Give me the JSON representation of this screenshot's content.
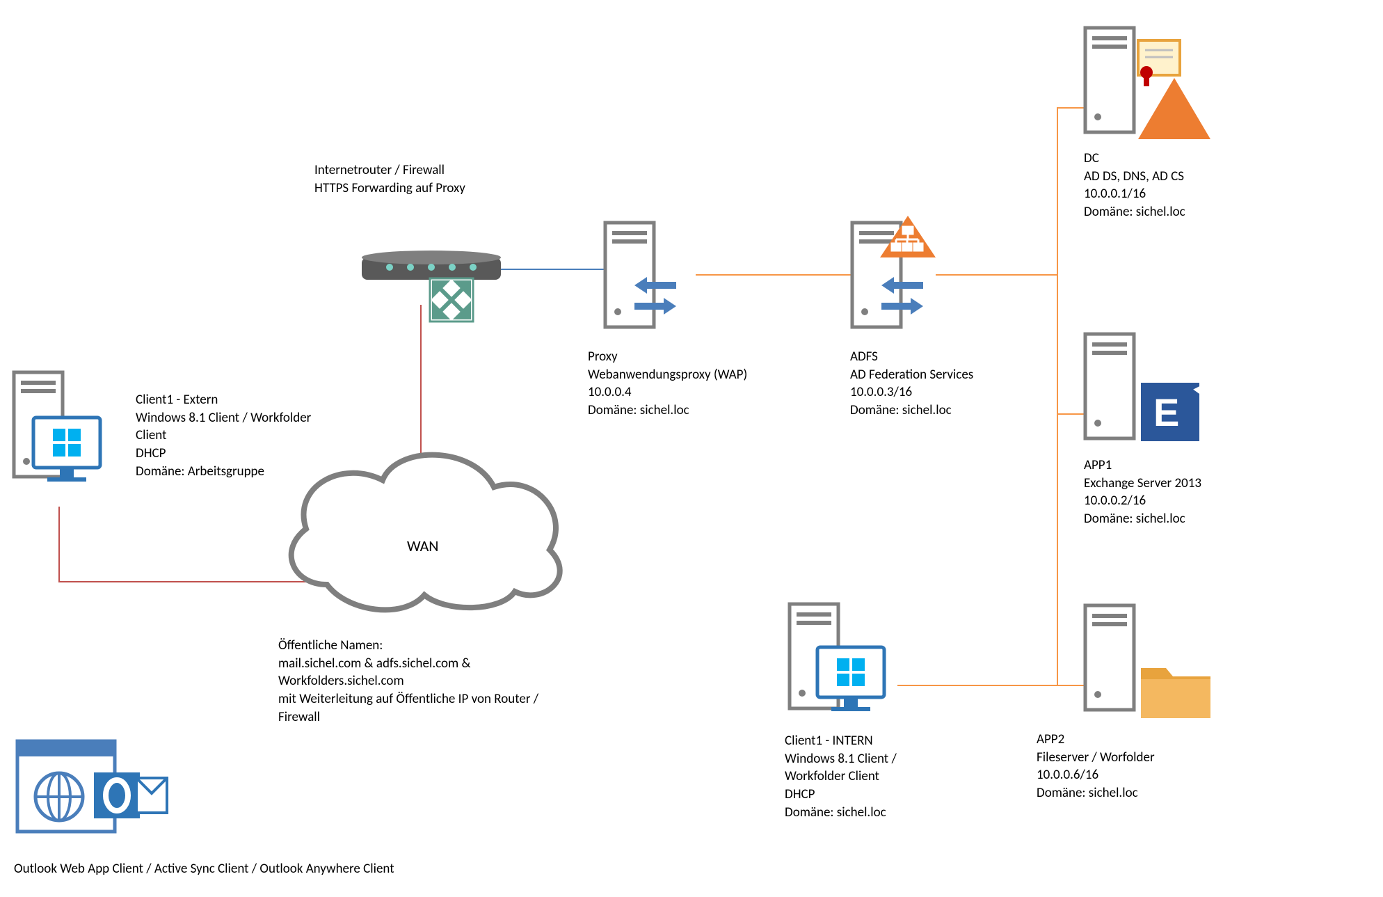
{
  "router": {
    "title": "Internetrouter / Firewall",
    "subtitle": "HTTPS Forwarding auf Proxy"
  },
  "client_ext": {
    "l1": "Client1 - Extern",
    "l2": "Windows 8.1 Client / Workfolder",
    "l3": "Client",
    "l4": "DHCP",
    "l5": "Domäne: Arbeitsgruppe"
  },
  "wan": {
    "label": "WAN"
  },
  "wan_names": {
    "l1": "Öffentliche Namen:",
    "l2": "mail.sichel.com & adfs.sichel.com &",
    "l3": "Workfolders.sichel.com",
    "l4": "mit Weiterleitung auf Öffentliche IP von Router /",
    "l5": "Firewall"
  },
  "proxy": {
    "l1": "Proxy",
    "l2": "Webanwendungsproxy (WAP)",
    "l3": "10.0.0.4",
    "l4": "Domäne: sichel.loc"
  },
  "adfs": {
    "l1": "ADFS",
    "l2": "AD Federation Services",
    "l3": "10.0.0.3/16",
    "l4": "Domäne: sichel.loc"
  },
  "dc": {
    "l1": "DC",
    "l2": "AD DS, DNS, AD CS",
    "l3": "10.0.0.1/16",
    "l4": "Domäne: sichel.loc"
  },
  "app1": {
    "l1": "APP1",
    "l2": "Exchange Server 2013",
    "l3": "10.0.0.2/16",
    "l4": "Domäne: sichel.loc"
  },
  "app2": {
    "l1": "APP2",
    "l2": "Fileserver / Worfolder",
    "l3": "10.0.0.6/16",
    "l4": "Domäne: sichel.loc"
  },
  "client_int": {
    "l1": "Client1 - INTERN",
    "l2": "Windows 8.1 Client /",
    "l3": "Workfolder Client",
    "l4": "DHCP",
    "l5": "Domäne: sichel.loc"
  },
  "owa": {
    "caption": "Outlook Web App Client / Active Sync Client / Outlook Anywhere Client"
  },
  "colors": {
    "blue_line": "#4A7EBB",
    "red_line": "#C0504D",
    "orange_line": "#F79646",
    "server_gray": "#7F7F7F",
    "win_blue": "#00B0F0",
    "ex_blue": "#2B579A",
    "orange": "#ED7D31",
    "folder": "#E8A33D",
    "teal": "#5B9B8B"
  }
}
